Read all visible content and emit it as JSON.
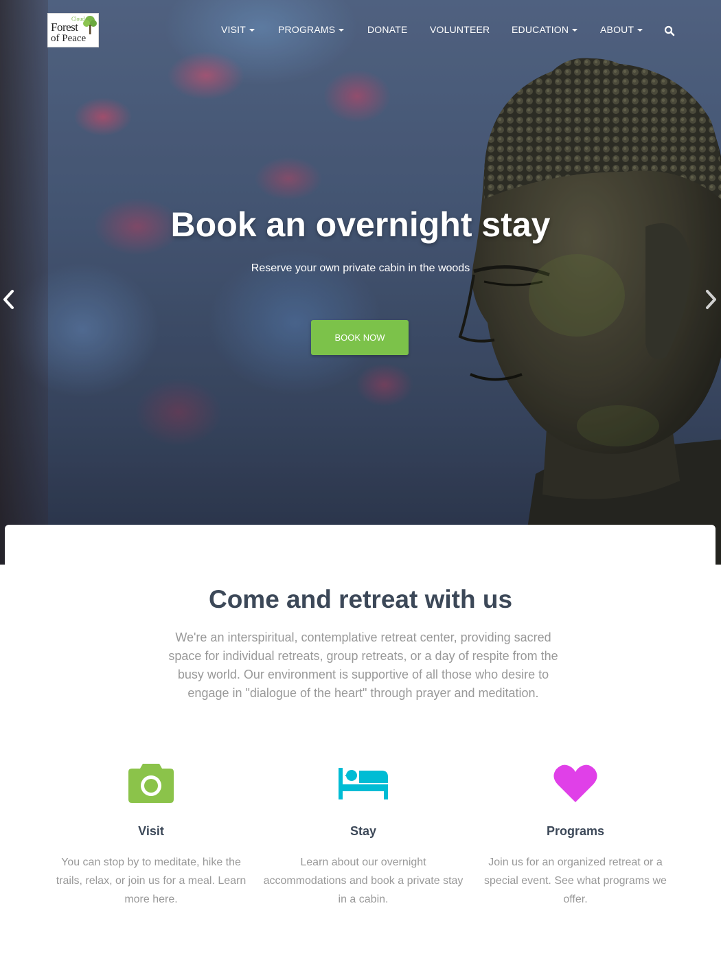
{
  "brand": {
    "logo_small": "Cloud",
    "logo_line1": "Forest",
    "logo_line2": "of Peace"
  },
  "nav": {
    "items": [
      {
        "label": "VISIT",
        "dropdown": true
      },
      {
        "label": "PROGRAMS",
        "dropdown": true
      },
      {
        "label": "DONATE",
        "dropdown": false
      },
      {
        "label": "VOLUNTEER",
        "dropdown": false
      },
      {
        "label": "EDUCATION",
        "dropdown": true
      },
      {
        "label": "ABOUT",
        "dropdown": true
      }
    ],
    "search_icon": "search-icon"
  },
  "hero": {
    "title": "Book an overnight stay",
    "subtitle": "Reserve your own private cabin in the woods",
    "button_label": "BOOK NOW",
    "button_color": "#7cc24a"
  },
  "intro": {
    "title": "Come and retreat with us",
    "description": "We're an interspiritual, contemplative retreat center, providing sacred space for individual retreats, group retreats, or a day of respite from the busy world. Our environment is supportive of all those who desire to engage in \"dialogue of the heart\" through prayer and meditation."
  },
  "features": [
    {
      "icon": "camera-icon",
      "color": "#8bc34a",
      "title": "Visit",
      "description": "You can stop by to meditate, hike the trails, relax, or join us for a meal. Learn more here."
    },
    {
      "icon": "bed-icon",
      "color": "#00bcd4",
      "title": "Stay",
      "description": "Learn about our overnight accommodations and book a private stay in a cabin."
    },
    {
      "icon": "heart-icon",
      "color": "#e040e8",
      "title": "Programs",
      "description": "Join us for an organized retreat or a special event. See what programs we offer."
    }
  ]
}
